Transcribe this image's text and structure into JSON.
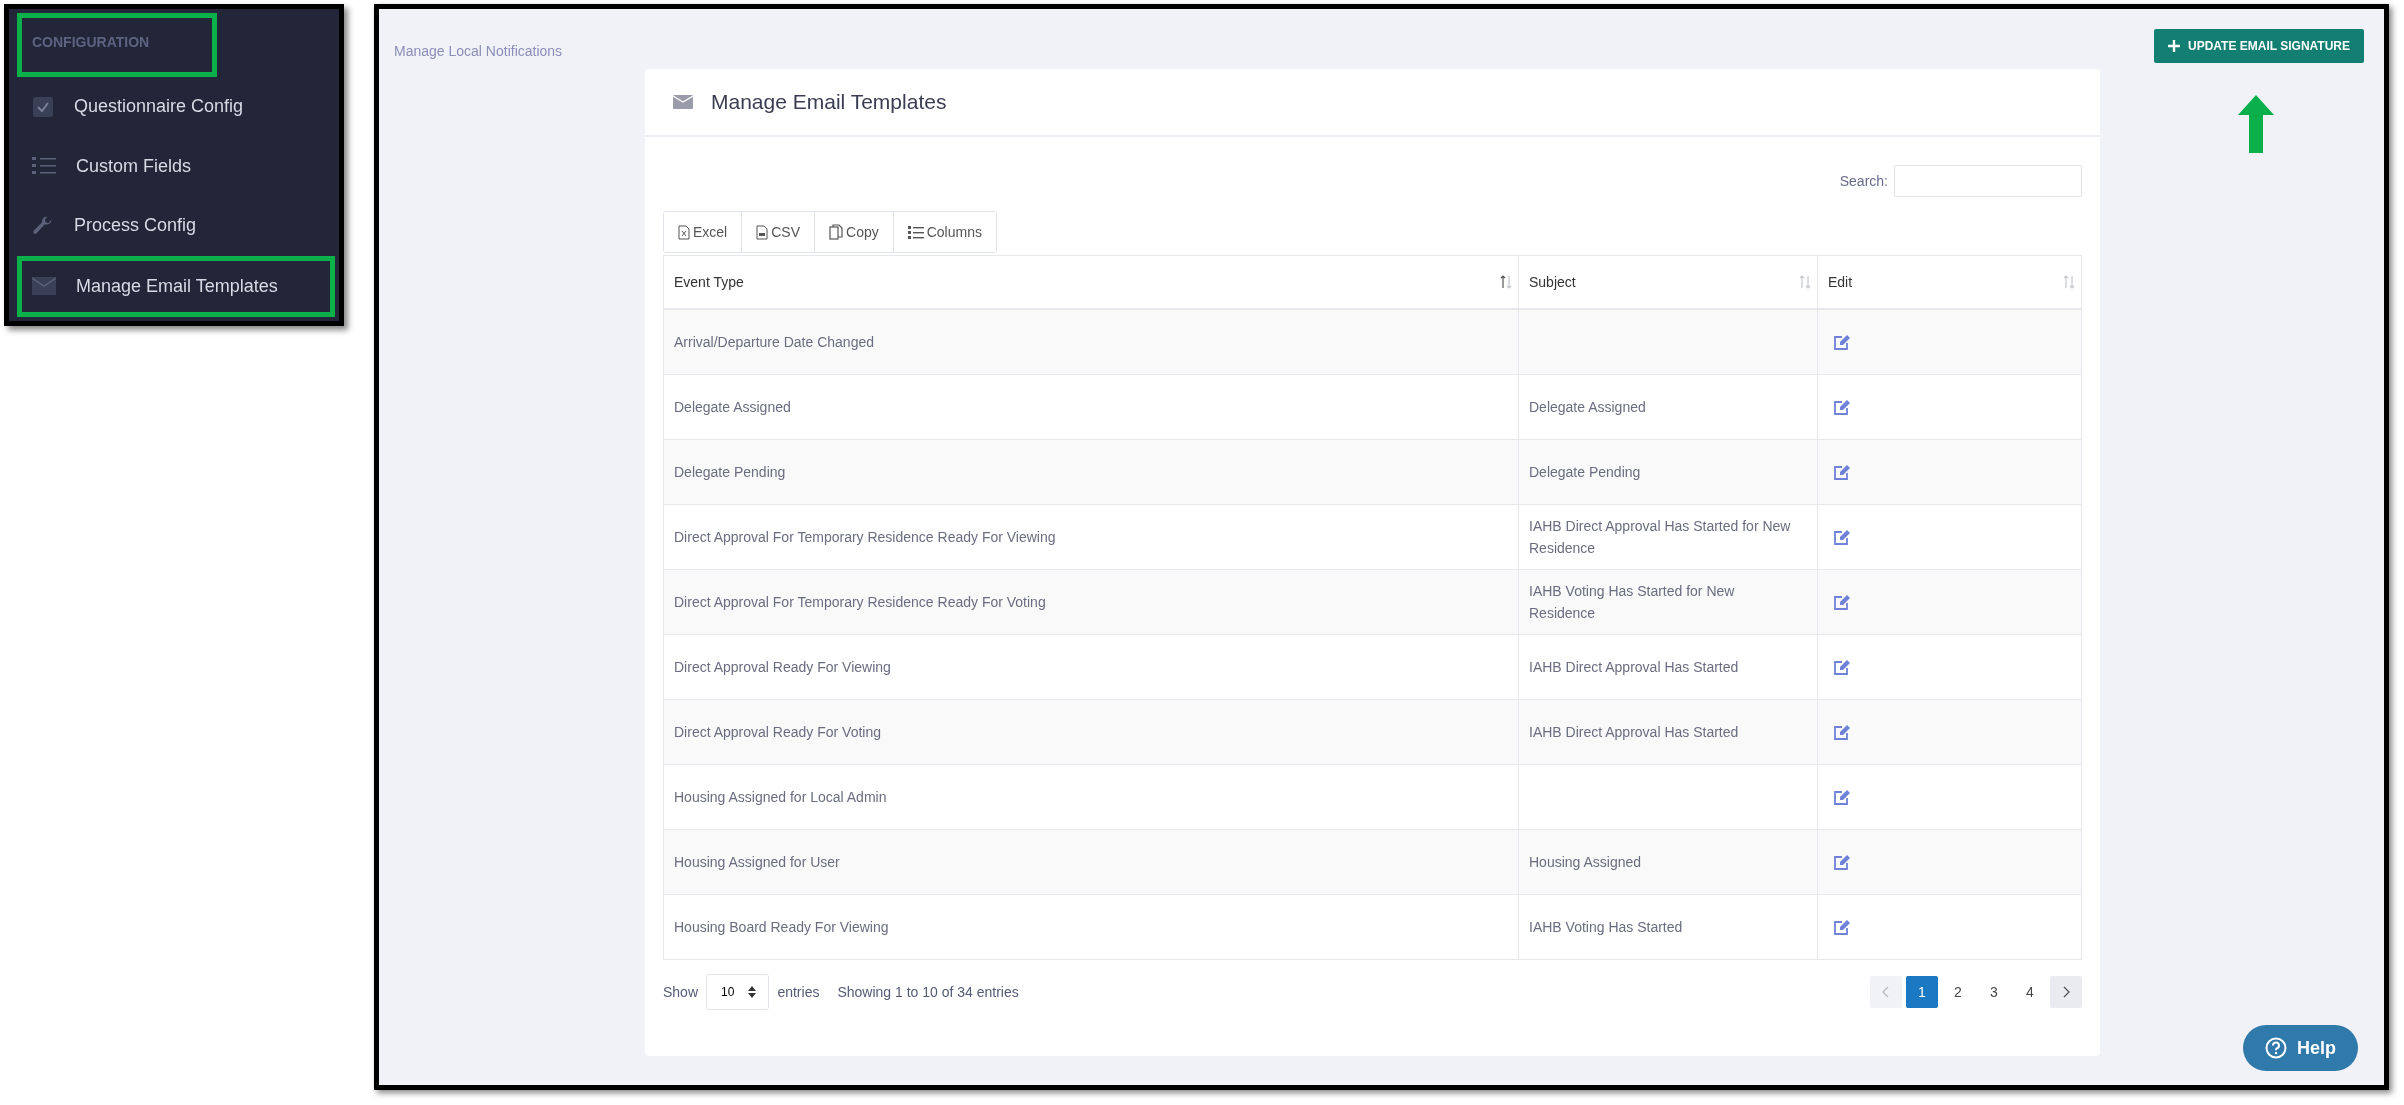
{
  "sidebar": {
    "section_title": {
      "label": "CONFIGURATION",
      "highlighted": true
    },
    "items": [
      {
        "label": "Questionnaire Config",
        "kind": "checkbox",
        "highlighted": false
      },
      {
        "label": "Custom Fields",
        "kind": "list",
        "highlighted": false
      },
      {
        "label": "Process Config",
        "kind": "wrench",
        "highlighted": false
      },
      {
        "label": "Manage Email Templates",
        "kind": "envelope",
        "highlighted": true
      }
    ]
  },
  "breadcrumb": "Manage Local Notifications",
  "header_button": {
    "label": "UPDATE EMAIL SIGNATURE",
    "pointed_at": true
  },
  "card": {
    "title": "Manage Email Templates",
    "search_label": "Search:",
    "export_buttons": [
      {
        "label": "Excel",
        "kind": "excel"
      },
      {
        "label": "CSV",
        "kind": "csv"
      },
      {
        "label": "Copy",
        "kind": "copy"
      },
      {
        "label": "Columns",
        "kind": "columns"
      }
    ],
    "table": {
      "columns": [
        {
          "label": "Event Type",
          "sorted": true
        },
        {
          "label": "Subject",
          "sorted": false
        },
        {
          "label": "Edit",
          "sorted": false
        }
      ],
      "rows": [
        {
          "event_type": "Arrival/Departure Date Changed"
        },
        {
          "event_type": "Delegate Assigned",
          "subject": "Delegate Assigned"
        },
        {
          "event_type": "Delegate Pending",
          "subject": "Delegate Pending"
        },
        {
          "event_type": "Direct Approval For Temporary Residence Ready For Viewing",
          "subject": "IAHB Direct Approval Has Started for New Residence"
        },
        {
          "event_type": "Direct Approval For Temporary Residence Ready For Voting",
          "subject": "IAHB Voting Has Started for New Residence"
        },
        {
          "event_type": "Direct Approval Ready For Viewing",
          "subject": "IAHB Direct Approval Has Started"
        },
        {
          "event_type": "Direct Approval Ready For Voting",
          "subject": "IAHB Direct Approval Has Started"
        },
        {
          "event_type": "Housing Assigned for Local Admin"
        },
        {
          "event_type": "Housing Assigned for User",
          "subject": "Housing Assigned"
        },
        {
          "event_type": "Housing Board Ready For Viewing",
          "subject": "IAHB Voting Has Started"
        }
      ]
    },
    "footer": {
      "show_label": "Show",
      "page_size": "10",
      "entries_label": "entries",
      "info": "Showing 1 to 10 of 34 entries",
      "prev_disabled": true,
      "next_disabled": false,
      "pages": [
        {
          "label": "1",
          "selected": true
        },
        {
          "label": "2",
          "selected": false
        },
        {
          "label": "3",
          "selected": false
        },
        {
          "label": "4",
          "selected": false
        }
      ]
    }
  },
  "help_button": "Help"
}
